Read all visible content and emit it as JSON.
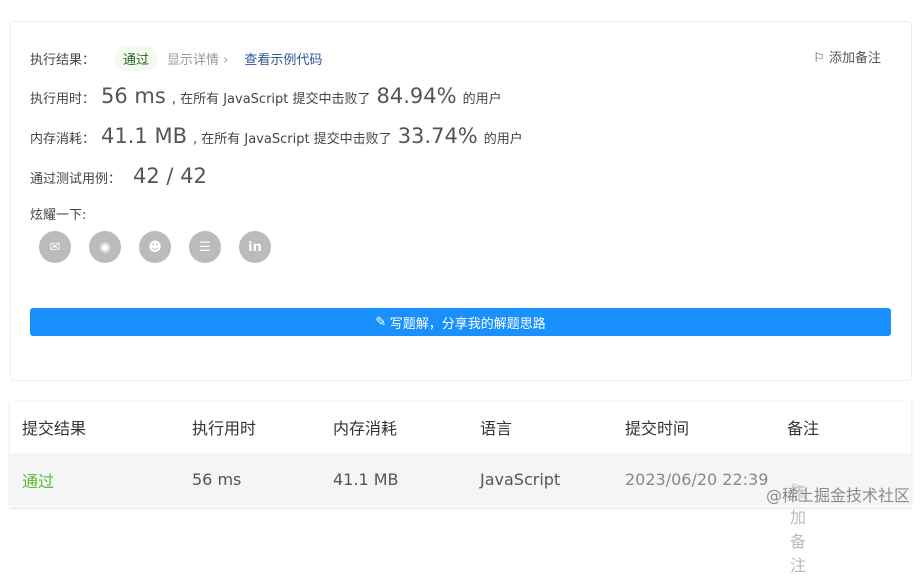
{
  "result": {
    "label": "执行结果：",
    "status": "通过",
    "details": "显示详情 ›",
    "example": "查看示例代码",
    "add_note": "添加备注"
  },
  "runtime": {
    "label": "执行用时：",
    "value": "56 ms",
    "text": ", 在所有 JavaScript 提交中击败了",
    "percent": "84.94%",
    "suffix": "的用户"
  },
  "memory": {
    "label": "内存消耗：",
    "value": "41.1 MB",
    "text": ", 在所有 JavaScript 提交中击败了",
    "percent": "33.74%",
    "suffix": "的用户"
  },
  "tests": {
    "label": "通过测试用例：",
    "value": "42 / 42"
  },
  "share": {
    "label": "炫耀一下:",
    "icons": [
      "wechat-icon",
      "weibo-icon",
      "qq-icon",
      "douban-icon",
      "linkedin-icon"
    ]
  },
  "write_button": "写题解，分享我的解题思路",
  "table": {
    "headers": [
      "提交结果",
      "执行用时",
      "内存消耗",
      "语言",
      "提交时间",
      "备注"
    ],
    "row": {
      "status": "通过",
      "runtime": "56 ms",
      "memory": "41.1 MB",
      "language": "JavaScript",
      "time": "2023/06/20 22:39",
      "note": "添加备注"
    }
  },
  "watermark": "@稀土掘金技术社区"
}
